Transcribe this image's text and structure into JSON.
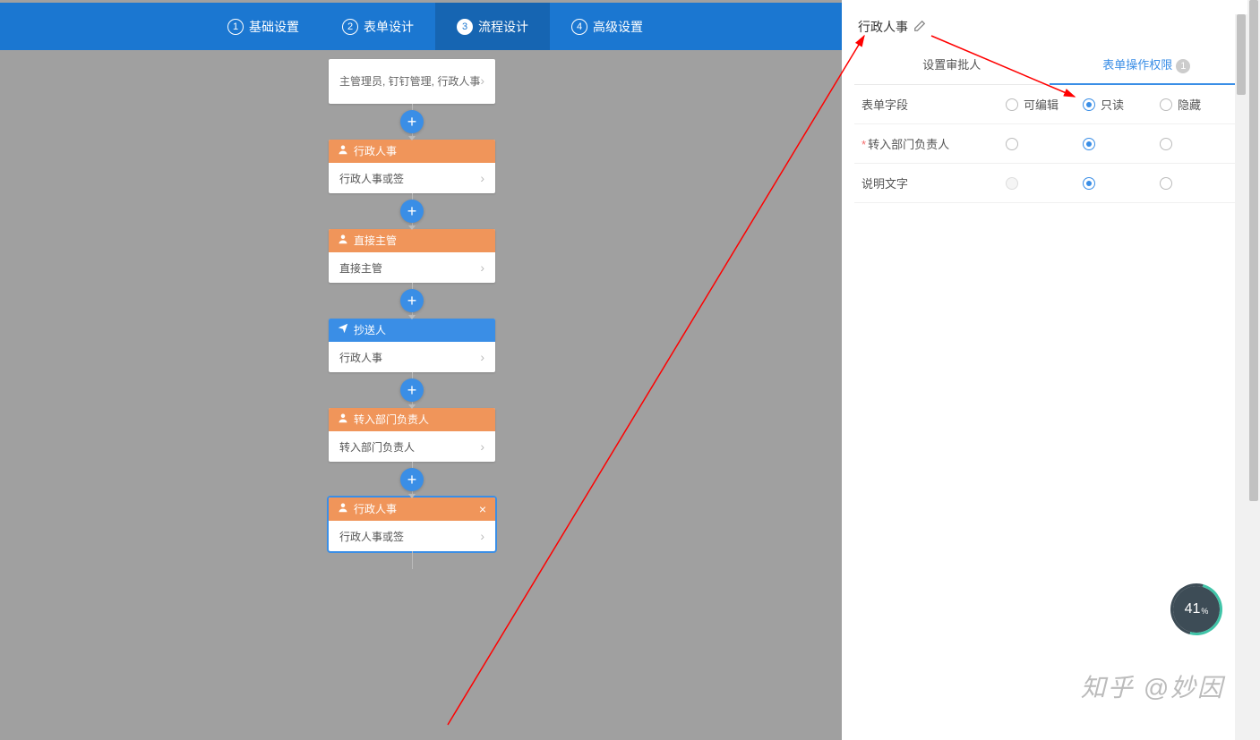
{
  "tabs": [
    {
      "num": "1",
      "label": "基础设置"
    },
    {
      "num": "2",
      "label": "表单设计"
    },
    {
      "num": "3",
      "label": "流程设计"
    },
    {
      "num": "4",
      "label": "高级设置"
    }
  ],
  "active_tab": 2,
  "flow": {
    "start_body": "主管理员, 钉钉管理, 行政人事",
    "nodes": [
      {
        "type": "approver",
        "title": "行政人事",
        "body": "行政人事或签",
        "color": "orange",
        "icon": "user"
      },
      {
        "type": "approver",
        "title": "直接主管",
        "body": "直接主管",
        "color": "orange",
        "icon": "user"
      },
      {
        "type": "cc",
        "title": "抄送人",
        "body": "行政人事",
        "color": "blue",
        "icon": "send"
      },
      {
        "type": "approver",
        "title": "转入部门负责人",
        "body": "转入部门负责人",
        "color": "orange",
        "icon": "user"
      },
      {
        "type": "approver",
        "title": "行政人事",
        "body": "行政人事或签",
        "color": "orange",
        "icon": "user",
        "selected": true,
        "closeable": true
      }
    ]
  },
  "side": {
    "title": "行政人事",
    "tabs": [
      {
        "label": "设置审批人"
      },
      {
        "label": "表单操作权限",
        "badge": "1"
      }
    ],
    "active_tab": 1,
    "header": {
      "field": "表单字段",
      "cols": [
        "可编辑",
        "只读",
        "隐藏"
      ],
      "header_selected": 1
    },
    "rows": [
      {
        "label": "转入部门负责人",
        "required": true,
        "selected": 1,
        "disabled0": false
      },
      {
        "label": "说明文字",
        "required": false,
        "selected": 1,
        "disabled0": true
      }
    ]
  },
  "progress": "41",
  "progress_unit": "%",
  "watermark": "知乎 @妙因"
}
